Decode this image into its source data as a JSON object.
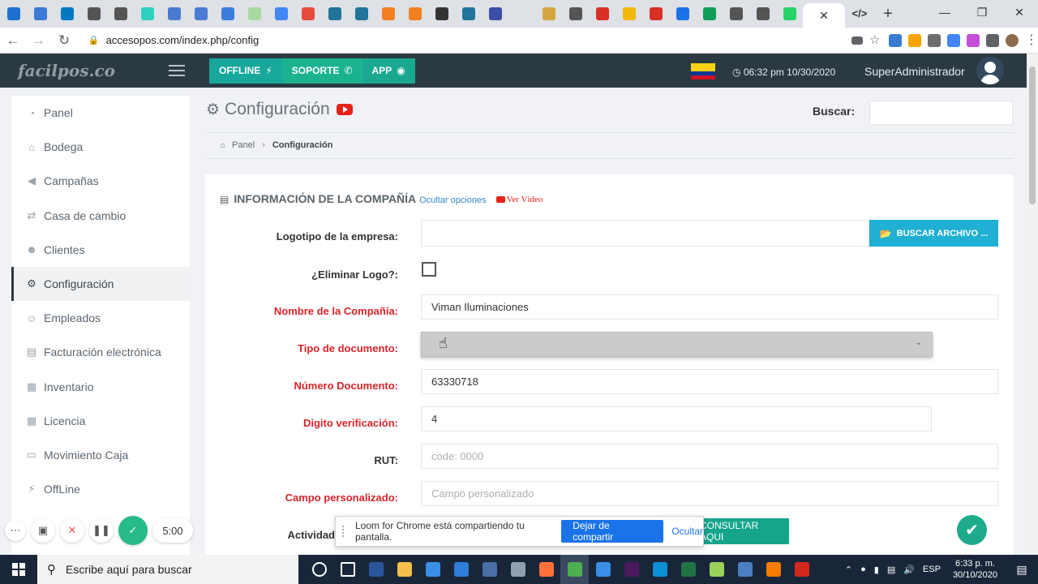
{
  "browser": {
    "url": "accesopos.com/index.php/config",
    "tabs": [
      {
        "icon": "tc-icon",
        "color": "#1f6fd1"
      },
      {
        "icon": "mail-icon",
        "color": "#3a7bd5"
      },
      {
        "icon": "trello-icon",
        "color": "#0079bf"
      },
      {
        "icon": "globe-icon",
        "color": "#555555"
      },
      {
        "icon": "globe-icon",
        "color": "#555555"
      },
      {
        "icon": "olx-icon",
        "color": "#2ed1c0"
      },
      {
        "icon": "circle-icon",
        "color": "#4a7bd0"
      },
      {
        "icon": "circle-icon",
        "color": "#4a7bd0"
      },
      {
        "icon": "c-icon",
        "color": "#3b7ddd"
      },
      {
        "icon": "wa-icon",
        "color": "#a7d8a0"
      },
      {
        "icon": "translate-icon",
        "color": "#4285f4"
      },
      {
        "icon": "pdf-icon",
        "color": "#e54b3c"
      },
      {
        "icon": "wordpress-icon",
        "color": "#21759b"
      },
      {
        "icon": "wordpress-icon",
        "color": "#21759b"
      },
      {
        "icon": "cloud-icon",
        "color": "#f38020"
      },
      {
        "icon": "cloud-icon",
        "color": "#f38020"
      },
      {
        "icon": "code-icon",
        "color": "#333333"
      },
      {
        "icon": "wordpress-icon",
        "color": "#21759b"
      },
      {
        "icon": "la-icon",
        "color": "#3b4ea8"
      },
      {
        "icon": "blank-icon",
        "color": "#dee1e6"
      },
      {
        "icon": "bowl-icon",
        "color": "#d4a640"
      },
      {
        "icon": "globe-icon",
        "color": "#555555"
      },
      {
        "icon": "gmail-icon",
        "color": "#d93025"
      },
      {
        "icon": "binance-icon",
        "color": "#f0b90b"
      },
      {
        "icon": "gmail-icon",
        "color": "#d93025"
      },
      {
        "icon": "at-icon",
        "color": "#1a73e8"
      },
      {
        "icon": "plus-icon",
        "color": "#0f9d58"
      },
      {
        "icon": "globe-icon",
        "color": "#555555"
      },
      {
        "icon": "globe-icon",
        "color": "#555555"
      },
      {
        "icon": "ws-icon",
        "color": "#25d366"
      }
    ],
    "active_tab_icon": "code-icon",
    "new_tab": "+",
    "window": {
      "minimize": "—",
      "maximize": "❐",
      "close": "✕"
    }
  },
  "app": {
    "brand": "facilpos.co",
    "buttons": {
      "offline": "OFFLINE",
      "support": "SOPORTE",
      "app": "APP"
    },
    "flag_colors": [
      "#fcd116",
      "#003893",
      "#ce1126"
    ],
    "clock": "06:32 pm 10/30/2020",
    "user": "SuperAdministrador"
  },
  "sidebar": {
    "items": [
      {
        "label": "Panel",
        "icon": "dashboard-icon"
      },
      {
        "label": "Bodega",
        "icon": "bank-icon"
      },
      {
        "label": "Campañas",
        "icon": "megaphone-icon"
      },
      {
        "label": "Casa de cambio",
        "icon": "exchange-icon"
      },
      {
        "label": "Clientes",
        "icon": "users-icon"
      },
      {
        "label": "Configuración",
        "icon": "gears-icon"
      },
      {
        "label": "Empleados",
        "icon": "user-icon"
      },
      {
        "label": "Facturación electrónica",
        "icon": "file-icon"
      },
      {
        "label": "Inventario",
        "icon": "table-icon"
      },
      {
        "label": "Licencia",
        "icon": "calendar-icon"
      },
      {
        "label": "Movimiento Caja",
        "icon": "money-icon"
      },
      {
        "label": "OffLine",
        "icon": "plug-icon"
      }
    ]
  },
  "page": {
    "title": "Configuración",
    "search_label": "Buscar:",
    "breadcrumb": {
      "home": "Panel",
      "current": "Configuración"
    },
    "section_title": "INFORMACIÓN DE LA COMPAÑÍA",
    "hide_options": "Ocultar opciones",
    "watch_video": "Ver Vídeo",
    "labels": {
      "logo": "Logotipo de la empresa:",
      "delete_logo": "¿Eliminar Logo?:",
      "company_name": "Nombre de la Compañía:",
      "doc_type": "Tipo de documento:",
      "doc_number": "Número Documento:",
      "check_digit": "Digito verificación:",
      "rut": "RUT:",
      "custom_field": "Campo personalizado:",
      "activity": "Actividad"
    },
    "file_button": "BUSCAR ARCHIVO ...",
    "values": {
      "company_name": "Viman Iluminaciones",
      "doc_number": "63330718",
      "check_digit": "4"
    },
    "placeholders": {
      "rut": "code: 0000",
      "custom_field": "Campo personalizado"
    },
    "consult_button": "CONSULTAR AQUI"
  },
  "loom": {
    "timer": "5:00",
    "share_message": "Loom for Chrome está compartiendo tu pantalla.",
    "stop_share": "Dejar de compartir",
    "hide": "Ocultar"
  },
  "taskbar": {
    "search_placeholder": "Escribe aquí para buscar",
    "lang": "ESP",
    "time": "6:33 p. m.",
    "date": "30/10/2020",
    "apps": [
      {
        "icon": "cortana-icon",
        "color": "#19263a"
      },
      {
        "icon": "taskview-icon",
        "color": "#19263a"
      },
      {
        "icon": "word-icon",
        "color": "#2b579a"
      },
      {
        "icon": "folder-icon",
        "color": "#f3c14a"
      },
      {
        "icon": "store-icon",
        "color": "#3a8ee6"
      },
      {
        "icon": "mail-icon",
        "color": "#2f7ed8"
      },
      {
        "icon": "calculator-icon",
        "color": "#4a6fa5"
      },
      {
        "icon": "app-icon",
        "color": "#8fa0b3"
      },
      {
        "icon": "firefox-icon",
        "color": "#ff7139"
      },
      {
        "icon": "chrome-icon",
        "color": "#4caf50"
      },
      {
        "icon": "chrome-icon",
        "color": "#3a8ee6"
      },
      {
        "icon": "premiere-icon",
        "color": "#4a1a5e"
      },
      {
        "icon": "edge-icon",
        "color": "#0c8fd6"
      },
      {
        "icon": "excel-icon",
        "color": "#217346"
      },
      {
        "icon": "xbox-icon",
        "color": "#9bd35a"
      },
      {
        "icon": "messenger-icon",
        "color": "#4a7fc1"
      },
      {
        "icon": "avast-icon",
        "color": "#f57c00"
      },
      {
        "icon": "acrobat-icon",
        "color": "#d4281c"
      }
    ]
  }
}
